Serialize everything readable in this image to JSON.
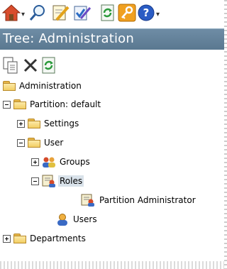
{
  "toolbar": {
    "items": [
      {
        "icon": "home-icon"
      },
      {
        "icon": "search-icon"
      },
      {
        "icon": "edit-document-icon"
      },
      {
        "icon": "edit-checked-icon"
      },
      {
        "icon": "refresh-icon"
      },
      {
        "icon": "key-icon"
      },
      {
        "icon": "help-icon"
      }
    ]
  },
  "panel": {
    "title": "Tree: Administration"
  },
  "actions": [
    {
      "icon": "copy-icon"
    },
    {
      "icon": "delete-icon"
    },
    {
      "icon": "refresh-icon"
    }
  ],
  "tree": {
    "root": "Administration",
    "partition": "Partition: default",
    "settings": "Settings",
    "user": "User",
    "groups": "Groups",
    "roles": "Roles",
    "partition_admin": "Partition Administrator",
    "users": "Users",
    "departments": "Departments"
  },
  "colors": {
    "title_bar": "#5f7d95",
    "selection": "#d9e2ea"
  }
}
